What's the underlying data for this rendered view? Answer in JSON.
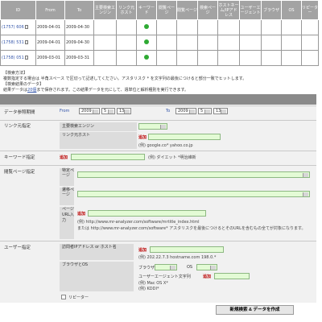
{
  "history": {
    "headers": [
      "ID",
      "From",
      "To",
      "主要検索エンジン",
      "リンク元ホスト",
      "キーワード",
      "閲覧ページ",
      "閲覧ページ",
      "検索ページ",
      "ホストネーム/IPアドレス",
      "ユーザーエージェント",
      "ブラウザ",
      "OS",
      "リピーター"
    ],
    "rows": [
      {
        "id": "(1757) 606",
        "from": "2009-04-01",
        "to": "2009-04-30"
      },
      {
        "id": "(1758) 531",
        "from": "2009-04-01",
        "to": "2009-04-30"
      },
      {
        "id": "(1758) 051",
        "from": "2009-03-01",
        "to": "2009-03-31"
      }
    ]
  },
  "notes": {
    "method_title": "【検索方法】",
    "method_text": "複数指定する場合は 半角スペース で区切って記述してください。アスタリスク * を文字列の最後につけると部分一致でヒットします。",
    "data_title": "【検索結果のデータ】",
    "data_text_a": "結果データは",
    "data_link": "20個",
    "data_text_b": "まで保存されます。この結果データを元にして、週単位と解析種別を実行できます。"
  },
  "period": {
    "label": "データ参照期間",
    "from_label": "From",
    "from_year": "2009",
    "from_month": "5",
    "from_day": "13",
    "to_label": "To",
    "to_year": "2009",
    "to_month": "5",
    "to_day": "13"
  },
  "referrer": {
    "label": "リンク元指定",
    "engine_label": "主要検索エンジン",
    "host_label": "リンク元ホスト",
    "add": "追加",
    "example": "(例) google.co* yahoo.co.jp"
  },
  "keyword": {
    "label": "キーワード指定",
    "add": "追加",
    "example": "(例) ダイエット *明治維新"
  },
  "pages": {
    "label": "閲覧ページ指定",
    "specific_label": "特定ページ",
    "transition_label": "遷移ページ",
    "url_label": "ページURL入力",
    "add": "追加",
    "example1": "(例) http://www.mr-analyzer.com/software/mrtitle_index.html",
    "example2": "または http://www.mr-analyzer.com/software* アスタリスクを最後につけるとそのURLを含むもの全てが対象になります。"
  },
  "user": {
    "label": "ユーザー指定",
    "ip_label": "訪問者IPアドレス or ホスト名",
    "add": "追加",
    "ip_example": "(例) 202.22.7.3 hostname.com 198.0.*",
    "bos_label": "ブラウザとOS",
    "browser_label": "ブラウザ",
    "os_label": "OS",
    "ua_label": "ユーザーエージェント文字列",
    "ua_add": "追加",
    "ua_example1": "(例) Mac OS X*",
    "ua_example2": "(例) KDDI*",
    "repeater_label": "リピーター"
  },
  "submit_label": "新規検索 & データを作成",
  "colors": {
    "header_gray": "#a3a3a3",
    "input_green": "#e3fbd5",
    "check_green": "#2eaa33",
    "plus_red": "#bb0000"
  }
}
